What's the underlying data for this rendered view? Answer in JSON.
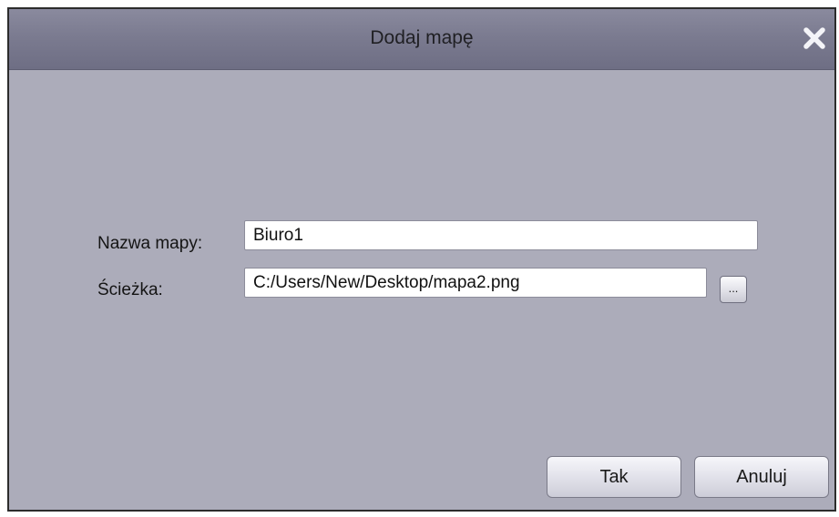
{
  "dialog": {
    "title": "Dodaj mapę",
    "close_icon": "close-x-icon"
  },
  "form": {
    "name_label": "Nazwa mapy:",
    "name_value": "Biuro1",
    "path_label": "Ścieżka:",
    "path_value": "C:/Users/New/Desktop/mapa2.png",
    "browse_label": "..."
  },
  "buttons": {
    "ok_label": "Tak",
    "cancel_label": "Anuluj"
  },
  "colors": {
    "dialog_background": "#acacba",
    "titlebar": "#7b7b90",
    "border": "#2c2c2c"
  }
}
